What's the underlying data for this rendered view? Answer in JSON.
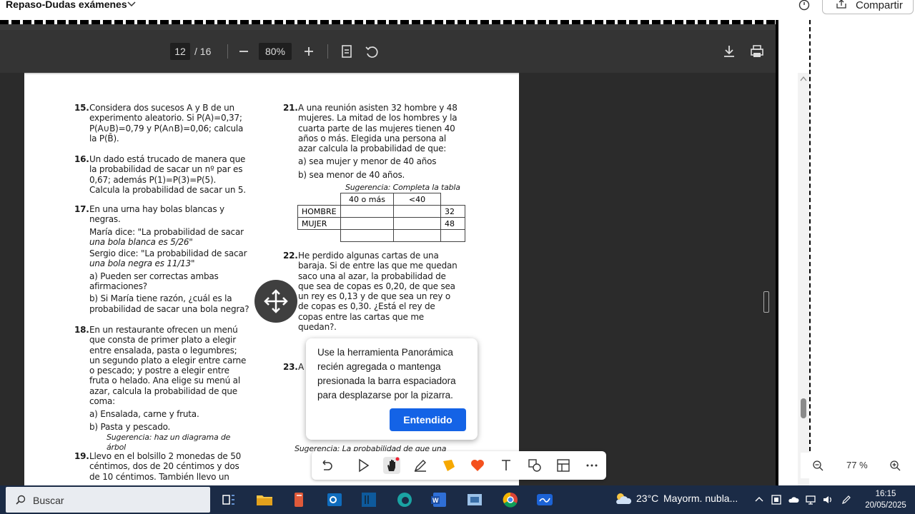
{
  "app": {
    "title": "Repaso-Dudas exámenes",
    "share_label": "Compartir"
  },
  "pdf_toolbar": {
    "page_current": "12",
    "page_total": "/ 16",
    "zoom": "80%"
  },
  "pdf_page": {
    "left_column": {
      "p15_num": "15.",
      "p15_l1": "Considera dos sucesos A y B de un",
      "p15_l2": "experimento aleatorio. Si P(A)=0,37;",
      "p15_l3": "P(A∪B)=0,79 y P(A∩B)=0,06; calcula",
      "p15_l4": "la P(B̄).",
      "p16_num": "16.",
      "p16_l1": "Un dado está trucado de manera que",
      "p16_l2": "la probabilidad de sacar un nº par es",
      "p16_l3": "0,67; además P(1)=P(3)=P(5).",
      "p16_l4": "Calcula la probabilidad de sacar un 5.",
      "p17_num": "17.",
      "p17_l1": "En una urna hay bolas blancas y",
      "p17_l2": "negras.",
      "p17_l3": "María dice: \"La probabilidad de sacar",
      "p17_l4": "una bola blanca es 5/26\"",
      "p17_l5": "Sergio dice: \"La probabilidad de sacar",
      "p17_l6": "una bola negra es 11/13\"",
      "p17_l7": "a)  Pueden  ser  correctas  ambas",
      "p17_l8": "afirmaciones?",
      "p17_l9": "b) Si María tiene razón, ¿cuál es la",
      "p17_l10": "probabilidad de sacar una bola negra?",
      "p18_num": "18.",
      "p18_l1": "En un restaurante ofrecen un menú",
      "p18_l2": "que consta de primer plato a elegir",
      "p18_l3": "entre ensalada, pasta o legumbres;",
      "p18_l4": "un segundo plato a elegir entre carne",
      "p18_l5": "o pescado; y postre a elegir entre",
      "p18_l6": "fruta o helado. Ana elige su menú al",
      "p18_l7": "azar, calcula la probabilidad de que",
      "p18_l8": "coma:",
      "p18_l9": "a) Ensalada, carne y fruta.",
      "p18_l10": "b) Pasta y pescado.",
      "p18_sugg": "Sugerencia: haz un diagrama de árbol",
      "p19_num": "19.",
      "p19_l1": "Llevo en el bolsillo 2 monedas de 50",
      "p19_l2": "céntimos, dos de 20 céntimos y dos",
      "p19_l3": "de 10 céntimos. También llevo un"
    },
    "right_column": {
      "p21_num": "21.",
      "p21_l1": "A una reunión asisten 32 hombre y 48",
      "p21_l2": "mujeres. La mitad de los hombres y la",
      "p21_l3": "cuarta parte de las mujeres tienen 40",
      "p21_l4": "años o más. Elegida una persona al",
      "p21_l5": "azar calcula la probabilidad de que:",
      "p21_a": "a) sea mujer y menor de 40 años",
      "p21_b": "b) sea menor de 40 años.",
      "p21_sugg": "Sugerencia: Completa la tabla",
      "table_h1": "40 o más",
      "table_h2": "<40",
      "row1_label": "HOMBRE",
      "row1_total": "32",
      "row2_label": "MUJER",
      "row2_total": "48",
      "p22_num": "22.",
      "p22_l1": "He perdido algunas cartas de una",
      "p22_l2": "baraja. Si de entre las que me quedan",
      "p22_l3": "saco una al azar, la probabilidad de",
      "p22_l4": "que sea de copas es 0,20, de que sea",
      "p22_l5": "un rey es 0,13 y de que sea un rey o",
      "p22_l6": "de copas es 0,30. ¿Está el rey de",
      "p22_l7": "copas  entre  las  cartas  que  me",
      "p22_l8": "quedan?.",
      "p23_num": "23.",
      "p23_start": "A",
      "p23_sugg": "Sugerencia: La probabilidad de que una"
    }
  },
  "tooltip": {
    "message": "Use la herramienta Panorámica recién agregada o mantenga presionada la barra espaciadora para desplazarse por la pizarra.",
    "button": "Entendido"
  },
  "zoom_panel": {
    "value": "77 %"
  },
  "taskbar": {
    "search_label": "Buscar",
    "weather_temp": "23°C",
    "weather_desc": "Mayorm. nubla...",
    "time": "16:15",
    "date": "20/05/2025"
  },
  "colors": {
    "accent_button": "#1463e6",
    "taskbar_bg": "#1b2b46",
    "pdf_bg": "#2b2b2b"
  },
  "icons": {
    "title_chevron": "chevron-down-icon",
    "timer": "timer-icon",
    "share": "share-icon",
    "zoom_out": "minus-icon",
    "zoom_in": "plus-icon",
    "fit": "fit-page-icon",
    "rotate": "rotate-icon",
    "download": "download-icon",
    "print": "print-icon",
    "more": "more-vertical-icon"
  }
}
